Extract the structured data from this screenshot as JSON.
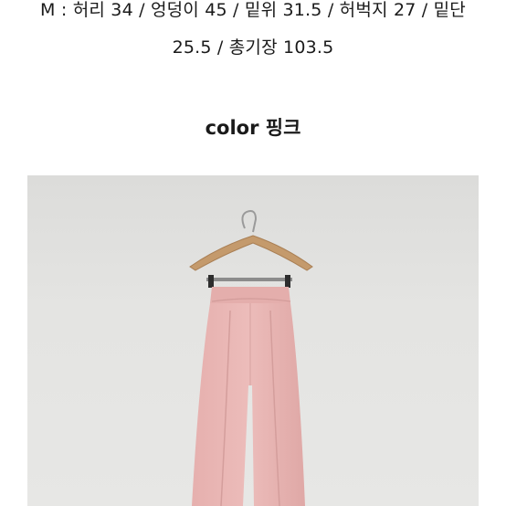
{
  "size_info": {
    "line1": "M : 허리 34 / 엉덩이 45 / 밑위 31.5 / 허벅지 27 / 밑단",
    "line2": "25.5 / 총기장 103.5"
  },
  "color_section": {
    "label": "color 핑크"
  },
  "product_photo": {
    "subject": "pink-wide-pants-on-hanger",
    "colors": {
      "background": "#e2e2e0",
      "hanger": "#c49a6c",
      "pants": "#e9b6b4",
      "pants_shadow": "#d49e9c"
    }
  }
}
